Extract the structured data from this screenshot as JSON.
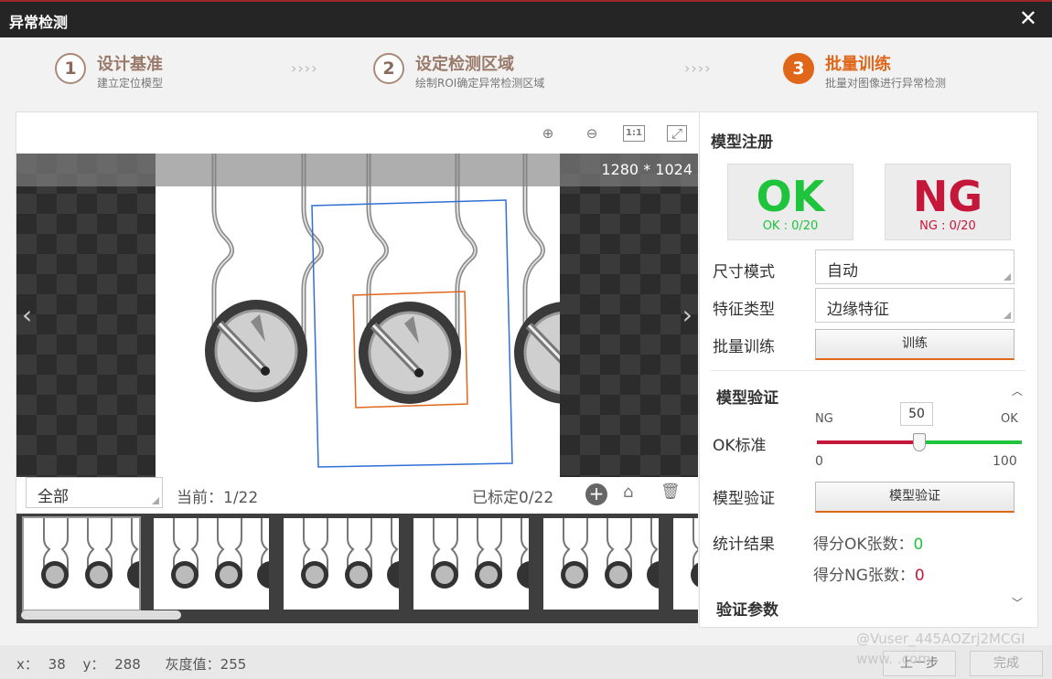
{
  "window": {
    "title": "异常检测",
    "close_label": "✕"
  },
  "steps": [
    {
      "num": "1",
      "title": "设计基准",
      "subtitle": "建立定位模型"
    },
    {
      "num": "2",
      "title": "设定检测区域",
      "subtitle": "绘制ROI确定异常检测区域"
    },
    {
      "num": "3",
      "title": "批量训练",
      "subtitle": "批量对图像进行异常检测"
    }
  ],
  "step_arrows": "››››",
  "toolbar": {
    "zoom_in": "⊕",
    "zoom_out": "⊖",
    "one_to_one": "1:1",
    "fit": "⤢"
  },
  "image": {
    "resolution": "1280 * 1024",
    "prev": "‹",
    "next": "›"
  },
  "controls": {
    "filter": "全部",
    "current": "当前：1/22",
    "labeled": "已标定0/22",
    "add": "+",
    "clear": "⌂",
    "delete": "🗑"
  },
  "panel": {
    "register_title": "模型注册",
    "ok_big": "OK",
    "ok_count": "OK : 0/20",
    "ng_big": "NG",
    "ng_count": "NG : 0/20",
    "size_mode_label": "尺寸模式",
    "size_mode_value": "自动",
    "feature_label": "特征类型",
    "feature_value": "边缘特征",
    "batch_label": "批量训练",
    "train_btn": "训练",
    "verify_title": "模型验证",
    "ok_std_label": "OK标准",
    "slider": {
      "value": "50",
      "left_label": "NG",
      "right_label": "OK",
      "min": "0",
      "max": "100",
      "ratio": 0.5
    },
    "verify_label": "模型验证",
    "verify_btn": "模型验证",
    "stats_label": "统计结果",
    "ok_score_label": "得分OK张数：",
    "ok_score": "0",
    "ng_score_label": "得分NG张数：",
    "ng_score": "0",
    "params_title": "验证参数"
  },
  "status": {
    "x_label": "x：",
    "x": "38",
    "y_label": "y：",
    "y": "288",
    "gray_label": "灰度值：",
    "gray": "255"
  },
  "footer": {
    "prev": "上一步",
    "finish": "完成"
  },
  "watermark": {
    "line1": "@Vuser_445AOZrj2MCGI",
    "line2": "www.  .com"
  },
  "colors": {
    "accent": "#e0661a",
    "ok": "#1ec43c",
    "ng": "#c4173a",
    "roi_outer": "#2f6fd6",
    "roi_inner": "#e0661a"
  }
}
